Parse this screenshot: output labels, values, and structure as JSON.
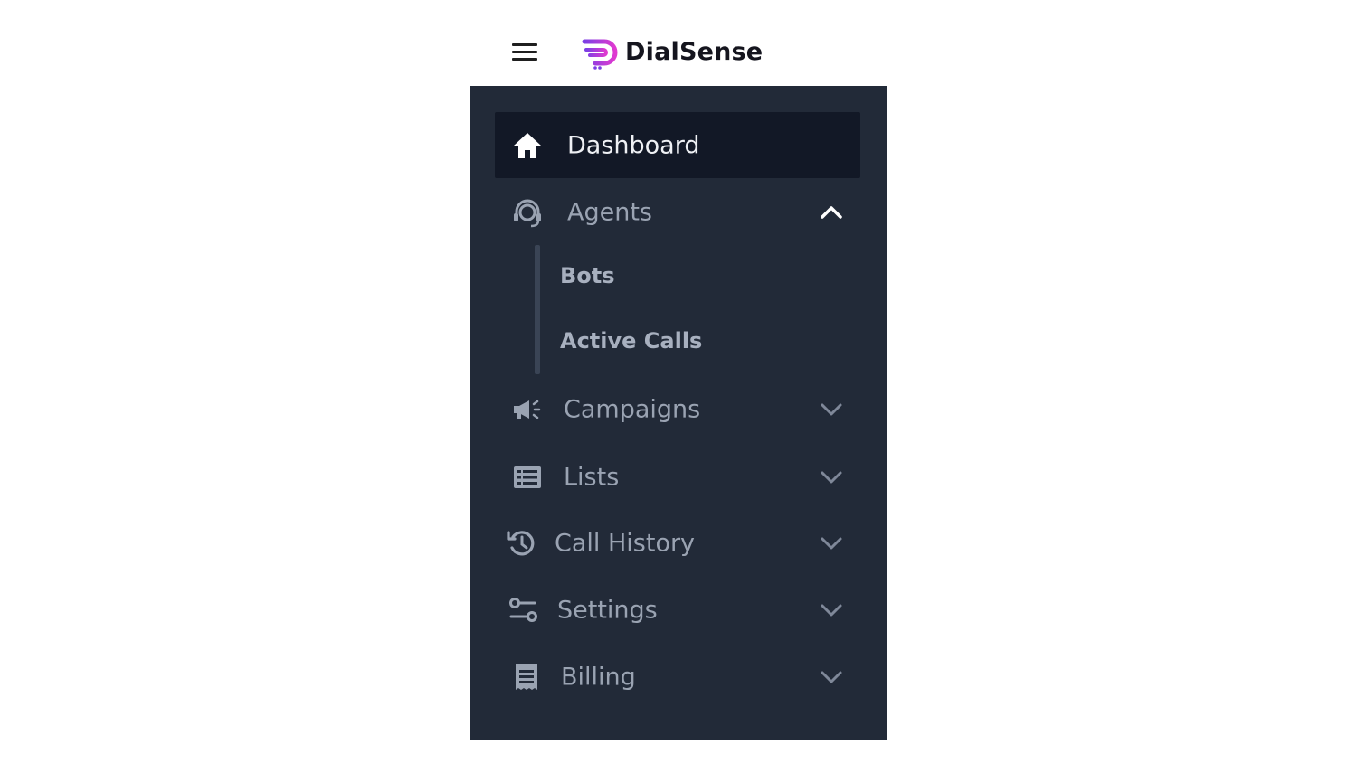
{
  "header": {
    "menu_icon": "hamburger-icon",
    "logo_icon": "dialsense-logo",
    "brand_name": "DialSense",
    "logo_gradient": [
      "#7b3fe4",
      "#e03ad0"
    ]
  },
  "sidebar": {
    "background": "#222a38",
    "active_background": "#121826",
    "items": [
      {
        "label": "Dashboard",
        "icon": "home-icon",
        "active": true,
        "expandable": false
      },
      {
        "label": "Agents",
        "icon": "headset-agent-icon",
        "active": false,
        "expandable": true,
        "expanded": true,
        "children": [
          {
            "label": "Bots"
          },
          {
            "label": "Active Calls"
          }
        ]
      },
      {
        "label": "Campaigns",
        "icon": "megaphone-icon",
        "expandable": true,
        "expanded": false
      },
      {
        "label": "Lists",
        "icon": "list-icon",
        "expandable": true,
        "expanded": false
      },
      {
        "label": "Call History",
        "icon": "history-icon",
        "expandable": true,
        "expanded": false
      },
      {
        "label": "Settings",
        "icon": "sliders-icon",
        "expandable": true,
        "expanded": false
      },
      {
        "label": "Billing",
        "icon": "receipt-icon",
        "expandable": true,
        "expanded": false
      }
    ]
  }
}
